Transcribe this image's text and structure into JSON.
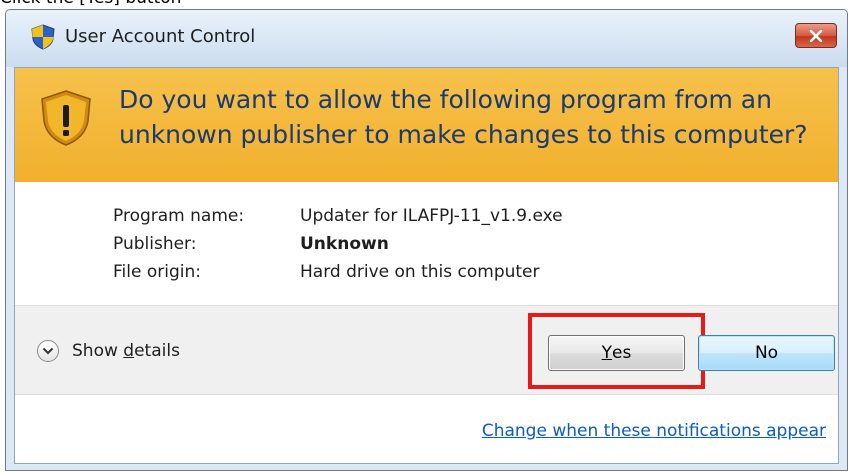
{
  "page_caption": "Click the [Yes] button",
  "window": {
    "title": "User Account Control",
    "icon": "uac-shield-icon",
    "close_icon": "close-icon"
  },
  "banner": {
    "icon": "warning-shield-icon",
    "question": "Do you want to allow the following program from an unknown publisher to make changes to this computer?"
  },
  "details": {
    "program_name_label": "Program name:",
    "program_name_value": "Updater for ILAFPJ-11_v1.9.exe",
    "publisher_label": "Publisher:",
    "publisher_value": "Unknown",
    "file_origin_label": "File origin:",
    "file_origin_value": "Hard drive on this computer"
  },
  "actions": {
    "show_details_prefix": "Show ",
    "show_details_mnemonic": "d",
    "show_details_suffix": "etails",
    "yes_mnemonic": "Y",
    "yes_rest": "es",
    "no_label": "No"
  },
  "footer": {
    "link": "Change when these notifications appear"
  },
  "colors": {
    "banner": "#f3b73a",
    "highlight": "#e81919",
    "link": "#0b5cc4"
  }
}
